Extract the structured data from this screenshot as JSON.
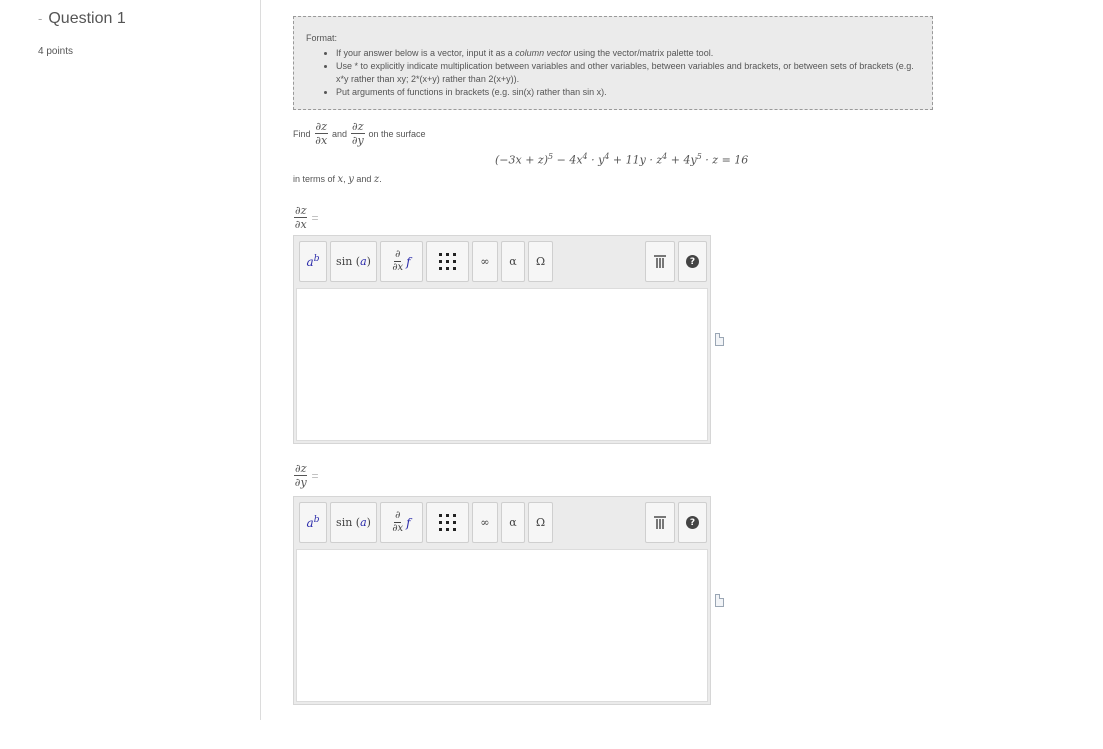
{
  "question": {
    "title": "Question 1",
    "points": "4 points"
  },
  "format_box": {
    "heading": "Format:",
    "bullets": [
      {
        "before": "If your answer below is a vector, input it as a ",
        "emphasis": "column vector",
        "after": " using the vector/matrix palette tool."
      },
      {
        "text": "Use * to explicitly indicate multiplication between variables and other variables, between variables and brackets, or between sets of brackets (e.g. x*y rather than xy; 2*(x+y) rather than 2(x+y))."
      },
      {
        "text": "Put arguments of functions in brackets (e.g. sin(x) rather than sin x)."
      }
    ]
  },
  "problem": {
    "find": "Find",
    "and": "and",
    "on_surface": "on the surface",
    "dz": "∂z",
    "dx": "∂x",
    "dy": "∂y",
    "equation": {
      "t1": "(−3x + z)",
      "t1_exp": "5",
      "t2": " − 4x",
      "t2_exp": "4",
      "t3": " · y",
      "t3_exp": "4",
      "t4": " + 11y · z",
      "t4_exp": "4",
      "t5": " + 4y",
      "t5_exp": "5",
      "t6": " · z = 16"
    },
    "in_terms": "in terms of",
    "var_x": "x",
    "var_y": "y",
    "and2": "and",
    "var_z": "z",
    "period": "."
  },
  "answers": [
    {
      "num": "∂z",
      "den": "∂x",
      "eq": "="
    },
    {
      "num": "∂z",
      "den": "∂y",
      "eq": "="
    }
  ],
  "toolbar": {
    "power_base": "a",
    "power_exp": "b",
    "sin_label": "sin",
    "sin_arg": "a",
    "deriv_num": "∂",
    "deriv_den": "∂x",
    "deriv_f": "f",
    "infinity": "∞",
    "alpha": "α",
    "omega": "Ω",
    "help": "?"
  },
  "icons": {
    "power": "superscript-icon",
    "function": "sine-function-icon",
    "derivative": "partial-derivative-icon",
    "matrix": "matrix-icon",
    "infinity": "infinity-icon",
    "greek_lower": "alpha-icon",
    "greek_upper": "omega-icon",
    "trash": "trash-icon",
    "help": "help-icon",
    "preview": "document-icon"
  },
  "colors": {
    "panel_bg": "#ebebeb",
    "accent_blue": "#2a2aaa",
    "text": "#555555"
  }
}
